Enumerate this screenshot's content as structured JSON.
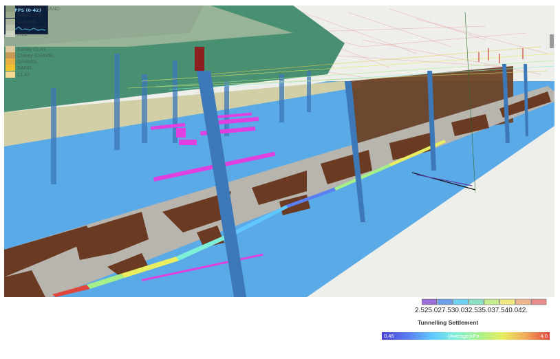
{
  "fps_panel": {
    "label": "18 FPS (0-42)"
  },
  "legend": {
    "items": [
      {
        "label": "Clayey Silty SAND",
        "color": "#8a9a7e"
      },
      {
        "label": "Silty/Sandy",
        "color": "#9aa88c"
      },
      {
        "label": "Gravelly",
        "color": "#a9b49a"
      },
      {
        "label": "CONCRETE",
        "color": "#b8c1aa"
      },
      {
        "label": "FILL",
        "color": "#cdd3c0"
      },
      {
        "label": "Sandy CLAY",
        "color": "#e0c9a0"
      },
      {
        "label": "Clayey GRAVEL",
        "color": "#c89a5a"
      },
      {
        "label": "GRAVEL",
        "color": "#e8b040"
      },
      {
        "label": "SAND",
        "color": "#f2c230"
      },
      {
        "label": "CLAY",
        "color": "#f6d890"
      }
    ]
  },
  "histogram": {
    "ticks": "2.525.027.530.032.535.037.540.042.",
    "bins": [
      {
        "count": 1,
        "color": "#9b6fd6"
      },
      {
        "count": 1,
        "color": "#6fa0e8"
      },
      {
        "count": 1,
        "color": "#6fd0f0"
      },
      {
        "count": 1,
        "color": "#8fe0c8"
      },
      {
        "count": 1,
        "color": "#c8ec90"
      },
      {
        "count": 1,
        "color": "#f0e880"
      },
      {
        "count": 1,
        "color": "#f0b890"
      },
      {
        "count": 1,
        "color": "#e89090"
      }
    ]
  },
  "colorbar": {
    "title": "Tunnelling Settlement",
    "min_label": "0.45",
    "center_label": "(Average)kPa",
    "max_label": "4.0"
  },
  "scene_colors": {
    "water": "#5aaae8",
    "soil_beige": "#d2cfa6",
    "green_block": "#3e8a6a",
    "tunnel_brown": "#6a3a22",
    "tunnel_grey": "#b8b4ae",
    "pile_blue": "#3d78b8",
    "block_brown": "#6e4226",
    "magenta": "#e040e0"
  }
}
